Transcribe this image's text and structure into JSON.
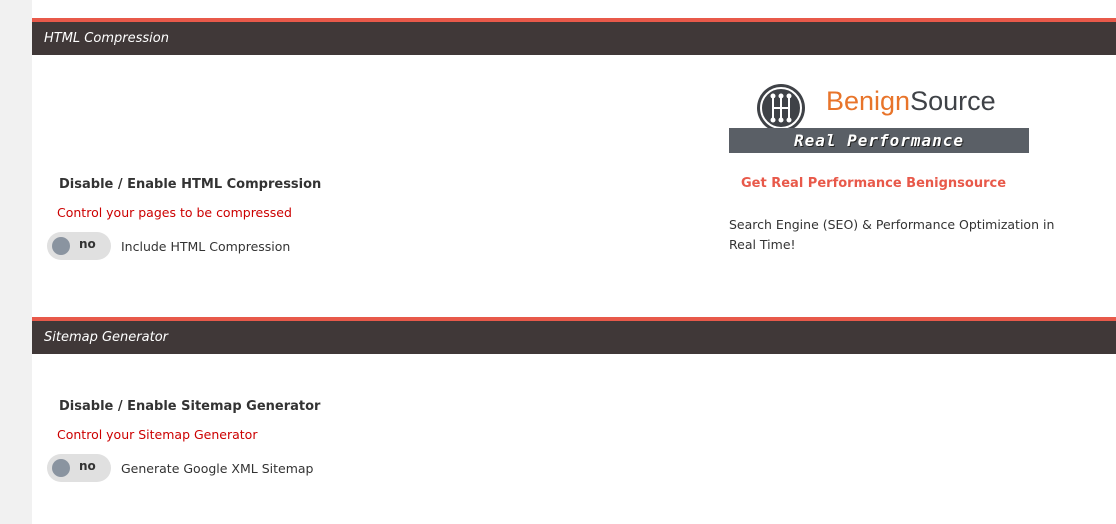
{
  "sections": [
    {
      "title": "HTML Compression",
      "option_title": "Disable / Enable HTML Compression",
      "option_desc": "Control your pages to be compressed",
      "toggle_state": "no",
      "toggle_label": "Include HTML Compression"
    },
    {
      "title": "Sitemap Generator",
      "option_title": "Disable / Enable Sitemap Generator",
      "option_desc": "Control your Sitemap Generator",
      "toggle_state": "no",
      "toggle_label": "Generate Google XML Sitemap"
    }
  ],
  "promo": {
    "brand_part1": "Benign",
    "brand_part2": "Source",
    "banner_text": "Real Performance",
    "link_text": "Get Real Performance Benignsource",
    "description": "Search Engine (SEO) & Performance Optimization in Real Time!"
  },
  "colors": {
    "accent": "#e8594a",
    "header_bg": "#403838",
    "desc_red": "#cc0000",
    "brand_orange": "#e8742a"
  }
}
